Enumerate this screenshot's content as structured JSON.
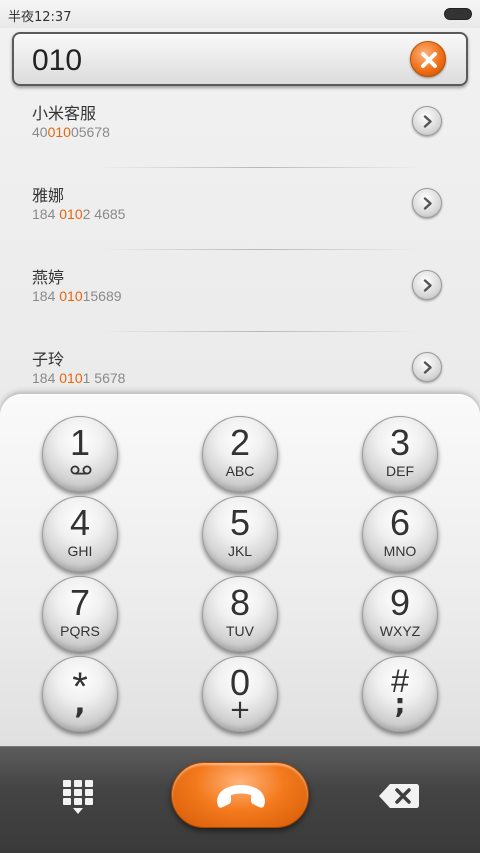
{
  "status_bar": {
    "time": "半夜12:37"
  },
  "search": {
    "query": "010"
  },
  "contacts": [
    {
      "name": "小米客服",
      "number_pre": "40",
      "number_match": "010",
      "number_post": "05678"
    },
    {
      "name": "雅娜",
      "number_pre": "184 ",
      "number_match": "010",
      "number_post": "2 4685"
    },
    {
      "name": "燕婷",
      "number_pre": "184 ",
      "number_match": "010",
      "number_post": "15689"
    },
    {
      "name": "子玲",
      "number_pre": "184 ",
      "number_match": "010",
      "number_post": "1 5678"
    }
  ],
  "keypad": {
    "keys": [
      {
        "digit": "1",
        "letters": ""
      },
      {
        "digit": "2",
        "letters": "ABC"
      },
      {
        "digit": "3",
        "letters": "DEF"
      },
      {
        "digit": "4",
        "letters": "GHI"
      },
      {
        "digit": "5",
        "letters": "JKL"
      },
      {
        "digit": "6",
        "letters": "MNO"
      },
      {
        "digit": "7",
        "letters": "PQRS"
      },
      {
        "digit": "8",
        "letters": "TUV"
      },
      {
        "digit": "9",
        "letters": "WXYZ"
      },
      {
        "digit": "*",
        "letters": ","
      },
      {
        "digit": "0",
        "letters": "+"
      },
      {
        "digit": "#",
        "letters": ";"
      }
    ]
  },
  "colors": {
    "accent": "#ee6a12",
    "highlight": "#e8650c",
    "bottom_bar": "#444444"
  },
  "icons": {
    "clear": "close-icon",
    "contact_action": "chevron-right-icon",
    "voicemail": "voicemail-icon",
    "dialpad": "dialpad-icon",
    "call": "phone-handset-icon",
    "backspace": "backspace-icon"
  }
}
